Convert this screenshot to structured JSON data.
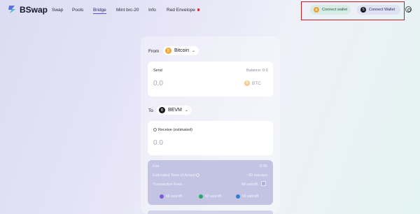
{
  "app": {
    "name": "BSwap"
  },
  "nav": {
    "swap": "Swap",
    "pools": "Pools",
    "bridge": "Bridge",
    "mint": "Mint brc-20",
    "info": "Info",
    "red_envelope": "Red Envelope"
  },
  "wallets": {
    "wallet1_label": "Connect wallet",
    "wallet2_label": "Connect Wallet"
  },
  "bridge": {
    "from_label": "From",
    "from_chain": "Bitcoin",
    "send_label": "Send",
    "balance": "Balance: 0.0",
    "send_amount": "0.0",
    "send_token": "BTC",
    "to_label": "To",
    "to_chain": "BEVM",
    "receive_label": "Receive (estimated)",
    "receive_amount": "0.0"
  },
  "fees": {
    "fee_label": "Fee",
    "fee_value": "0.00",
    "eta_label": "Estimated Time of Arrival",
    "eta_value": "~30 minutes",
    "tx_fees_label": "Transaction Fees",
    "tx_fees_value": "66 sat/vB",
    "options": [
      {
        "label": "66 sats/vB",
        "color": "#7b5cd6"
      },
      {
        "label": "63 sats/vB",
        "color": "#2aa86a"
      },
      {
        "label": "56 sats/vB",
        "color": "#2f7fd4"
      }
    ]
  }
}
